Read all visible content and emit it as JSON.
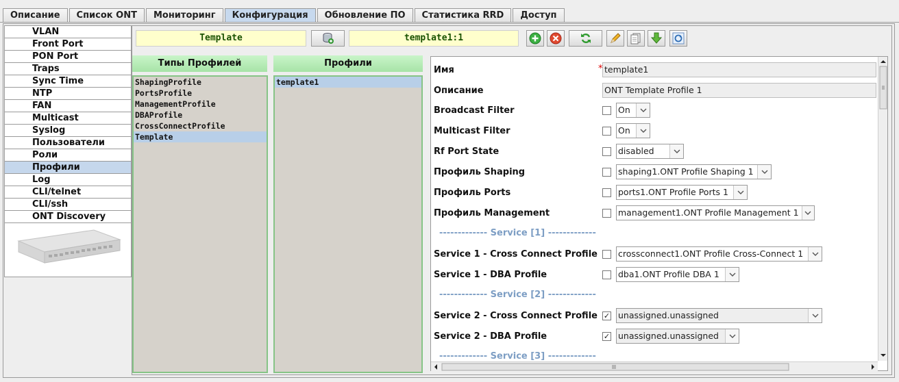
{
  "tabs": [
    "Описание",
    "Список ONT",
    "Мониторинг",
    "Конфигурация",
    "Обновление ПО",
    "Статистика RRD",
    "Доступ"
  ],
  "active_tab": "Конфигурация",
  "sidebar": {
    "items": [
      "VLAN",
      "Front Port",
      "PON Port",
      "Traps",
      "Sync Time",
      "NTP",
      "FAN",
      "Multicast",
      "Syslog",
      "Пользователи",
      "Роли",
      "Профили",
      "Log",
      "CLI/telnet",
      "CLI/ssh",
      "ONT Discovery"
    ],
    "active": "Профили"
  },
  "toolbar": {
    "profile_type_field": "Template",
    "profile_field": "template1:1",
    "icons": [
      "database-refresh-icon",
      "add-icon",
      "delete-icon",
      "refresh-icon",
      "edit-icon",
      "copy-icon",
      "download-icon",
      "sync-icon"
    ]
  },
  "profile_types": {
    "header": "Типы Профилей",
    "items": [
      "ShapingProfile",
      "PortsProfile",
      "ManagementProfile",
      "DBAProfile",
      "CrossConnectProfile",
      "Template"
    ],
    "selected": "Template"
  },
  "profiles": {
    "header": "Профили",
    "items": [
      "template1"
    ],
    "selected": "template1"
  },
  "form": {
    "name_label": "Имя",
    "name_required_mark": "*",
    "name_value": "template1",
    "desc_label": "Описание",
    "desc_value": "ONT Template Profile 1",
    "rows": [
      {
        "label": "Broadcast Filter",
        "checked": false,
        "value": "On"
      },
      {
        "label": "Multicast Filter",
        "checked": false,
        "value": "On"
      },
      {
        "label": "Rf Port State",
        "checked": false,
        "value": "disabled"
      },
      {
        "label": "Профиль Shaping",
        "checked": false,
        "value": "shaping1.ONT Profile Shaping 1"
      },
      {
        "label": "Профиль Ports",
        "checked": false,
        "value": "ports1.ONT Profile Ports 1"
      },
      {
        "label": "Профиль Management",
        "checked": false,
        "value": "management1.ONT Profile Management 1"
      },
      {
        "label": "Service 1 - Cross Connect Profile",
        "checked": false,
        "value": "crossconnect1.ONT Profile Cross-Connect 1"
      },
      {
        "label": "Service 1 - DBA Profile",
        "checked": false,
        "value": "dba1.ONT Profile DBA 1"
      },
      {
        "label": "Service 2 - Cross Connect Profile",
        "checked": true,
        "value": "unassigned.unassigned"
      },
      {
        "label": "Service 2 - DBA Profile",
        "checked": true,
        "value": "unassigned.unassigned"
      }
    ],
    "separators": [
      "------------- Service [1] -------------",
      "------------- Service [2] -------------",
      "------------- Service [3] -------------"
    ]
  }
}
